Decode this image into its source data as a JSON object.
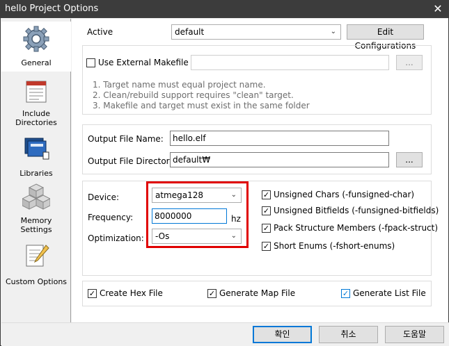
{
  "window": {
    "title": "hello Project Options",
    "close_glyph": "✕"
  },
  "sidebar": {
    "items": [
      {
        "label_lines": [
          "General"
        ],
        "icon": "gear-icon"
      },
      {
        "label_lines": [
          "Include",
          "Directories"
        ],
        "icon": "include-directories-icon"
      },
      {
        "label_lines": [
          "Libraries"
        ],
        "icon": "libraries-icon"
      },
      {
        "label_lines": [
          "Memory",
          "Settings"
        ],
        "icon": "memory-settings-icon"
      },
      {
        "label_lines": [
          "Custom Options"
        ],
        "icon": "custom-options-icon"
      }
    ]
  },
  "active": {
    "label": "Active",
    "value": "default",
    "edit_button": "Edit Configurations"
  },
  "makefile": {
    "checkbox_label": "Use External Makefile",
    "checked": false,
    "path_value": "",
    "browse_button": "...",
    "notes": [
      "1. Target name must equal project name.",
      "2. Clean/rebuild support requires  \"clean\" target.",
      "3. Makefile and target must exist in the same folder"
    ]
  },
  "output": {
    "file_name_label": "Output File Name:",
    "file_name_value": "hello.elf",
    "dir_label": "Output File Directory:",
    "dir_value": "default₩",
    "browse_button": "..."
  },
  "device": {
    "device_label": "Device:",
    "device_value": "atmega128",
    "frequency_label": "Frequency:",
    "frequency_value": "8000000",
    "frequency_unit": "hz",
    "optimization_label": "Optimization:",
    "optimization_value": "-Os",
    "highlight_color": "#e00000"
  },
  "compiler_flags": [
    {
      "label": "Unsigned Chars (-funsigned-char)",
      "checked": true
    },
    {
      "label": "Unsigned Bitfields (-funsigned-bitfields)",
      "checked": true
    },
    {
      "label": "Pack Structure Members (-fpack-struct)",
      "checked": true
    },
    {
      "label": "Short Enums (-fshort-enums)",
      "checked": true
    }
  ],
  "outputs": [
    {
      "label": "Create Hex File",
      "checked": true
    },
    {
      "label": "Generate Map File",
      "checked": true
    },
    {
      "label": "Generate List File",
      "checked": true
    }
  ],
  "footer": {
    "ok": "확인",
    "cancel": "취소",
    "help": "도움말"
  },
  "check_glyph": "✓",
  "dropdown_glyph": "⌄"
}
